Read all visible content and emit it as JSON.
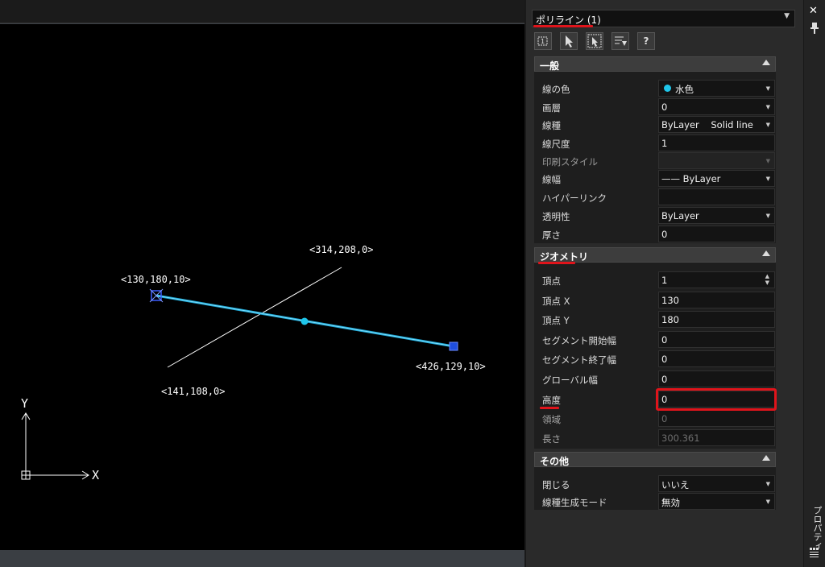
{
  "canvas": {
    "labels": {
      "p1": "<130,180,10>",
      "p2": "<426,129,10>",
      "p3": "<314,208,0>",
      "p4": "<141,108,0>"
    },
    "axis_y": "Y",
    "axis_x": "X"
  },
  "palette": {
    "selector": "ポリライン (1)",
    "toolbar": {
      "help": "?"
    },
    "sections": {
      "general": {
        "title": "一般",
        "rows": [
          {
            "label": "線の色",
            "value": "水色"
          },
          {
            "label": "画層",
            "value": "0"
          },
          {
            "label": "線種",
            "value": "ByLayer    Solid line"
          },
          {
            "label": "線尺度",
            "value": "1"
          },
          {
            "label": "印刷スタイル",
            "value": ""
          },
          {
            "label": "線幅",
            "value": "—— ByLayer"
          },
          {
            "label": "ハイパーリンク",
            "value": ""
          },
          {
            "label": "透明性",
            "value": "ByLayer"
          },
          {
            "label": "厚さ",
            "value": "0"
          }
        ]
      },
      "geometry": {
        "title": "ジオメトリ",
        "rows": [
          {
            "label": "頂点",
            "value": "1"
          },
          {
            "label": "頂点 X",
            "value": "130"
          },
          {
            "label": "頂点 Y",
            "value": "180"
          },
          {
            "label": "セグメント開始幅",
            "value": "0"
          },
          {
            "label": "セグメント終了幅",
            "value": "0"
          },
          {
            "label": "グローバル幅",
            "value": "0"
          },
          {
            "label": "高度",
            "value": "0"
          },
          {
            "label": "領域",
            "value": "0"
          },
          {
            "label": "長さ",
            "value": "300.361"
          }
        ]
      },
      "other": {
        "title": "その他",
        "rows": [
          {
            "label": "閉じる",
            "value": "いいえ"
          },
          {
            "label": "線種生成モード",
            "value": "無効"
          }
        ]
      }
    }
  },
  "strip": {
    "close": "✕",
    "label": "プロパティ"
  },
  "colors": {
    "accent_red": "#e0141b",
    "polyline": "#1fa8d6",
    "grip": "#1f4fe0"
  }
}
